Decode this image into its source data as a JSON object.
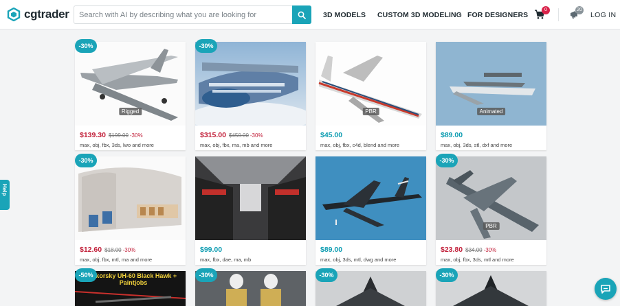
{
  "header": {
    "logo_text": "cgtrader",
    "search": {
      "placeholder": "Search with AI by describing what you are looking for",
      "value": ""
    },
    "nav": [
      "3D MODELS",
      "CUSTOM 3D MODELING",
      "FOR DESIGNERS"
    ],
    "cart_count": "0",
    "notifications_count": "20",
    "login_label": "LOG IN"
  },
  "help_label": "Help",
  "products": [
    {
      "discount": "-30%",
      "tag": "Rigged",
      "price": "$139.30",
      "old_price": "$199.00",
      "pct": "-30%",
      "formats": "max, obj, fbx, 3ds, lwo and more",
      "sale": true
    },
    {
      "discount": "-30%",
      "tag": "",
      "price": "$315.00",
      "old_price": "$450.00",
      "pct": "-30%",
      "formats": "max, obj, fbx, ma, mb and more",
      "sale": true
    },
    {
      "discount": "",
      "tag": "PBR",
      "price": "$45.00",
      "old_price": "",
      "pct": "",
      "formats": "max, obj, fbx, c4d, blend and more",
      "sale": false
    },
    {
      "discount": "",
      "tag": "Animated",
      "price": "$89.00",
      "old_price": "",
      "pct": "",
      "formats": "max, obj, 3ds, stl, dxf and more",
      "sale": false
    },
    {
      "discount": "-30%",
      "tag": "",
      "price": "$12.60",
      "old_price": "$18.00",
      "pct": "-30%",
      "formats": "max, obj, fbx, mtl, ma and more",
      "sale": true
    },
    {
      "discount": "",
      "tag": "",
      "price": "$99.00",
      "old_price": "",
      "pct": "",
      "formats": "max, fbx, dae, ma, mb",
      "sale": false
    },
    {
      "discount": "",
      "tag": "",
      "price": "$89.00",
      "old_price": "",
      "pct": "",
      "formats": "max, obj, 3ds, mtl, dwg and more",
      "sale": false
    },
    {
      "discount": "-30%",
      "tag": "PBR",
      "price": "$23.80",
      "old_price": "$34.00",
      "pct": "-30%",
      "formats": "max, obj, fbx, 3ds, mtl and more",
      "sale": true
    },
    {
      "discount": "-50%",
      "thumb_text": "Sikorsky UH-60 Black Hawk + Paintjobs"
    },
    {
      "discount": "-30%"
    },
    {
      "discount": "-30%"
    },
    {
      "discount": "-30%"
    }
  ],
  "colors": {
    "accent": "#1aa4b8",
    "sale_price": "#c2203a",
    "price": "#0c9cb1"
  }
}
